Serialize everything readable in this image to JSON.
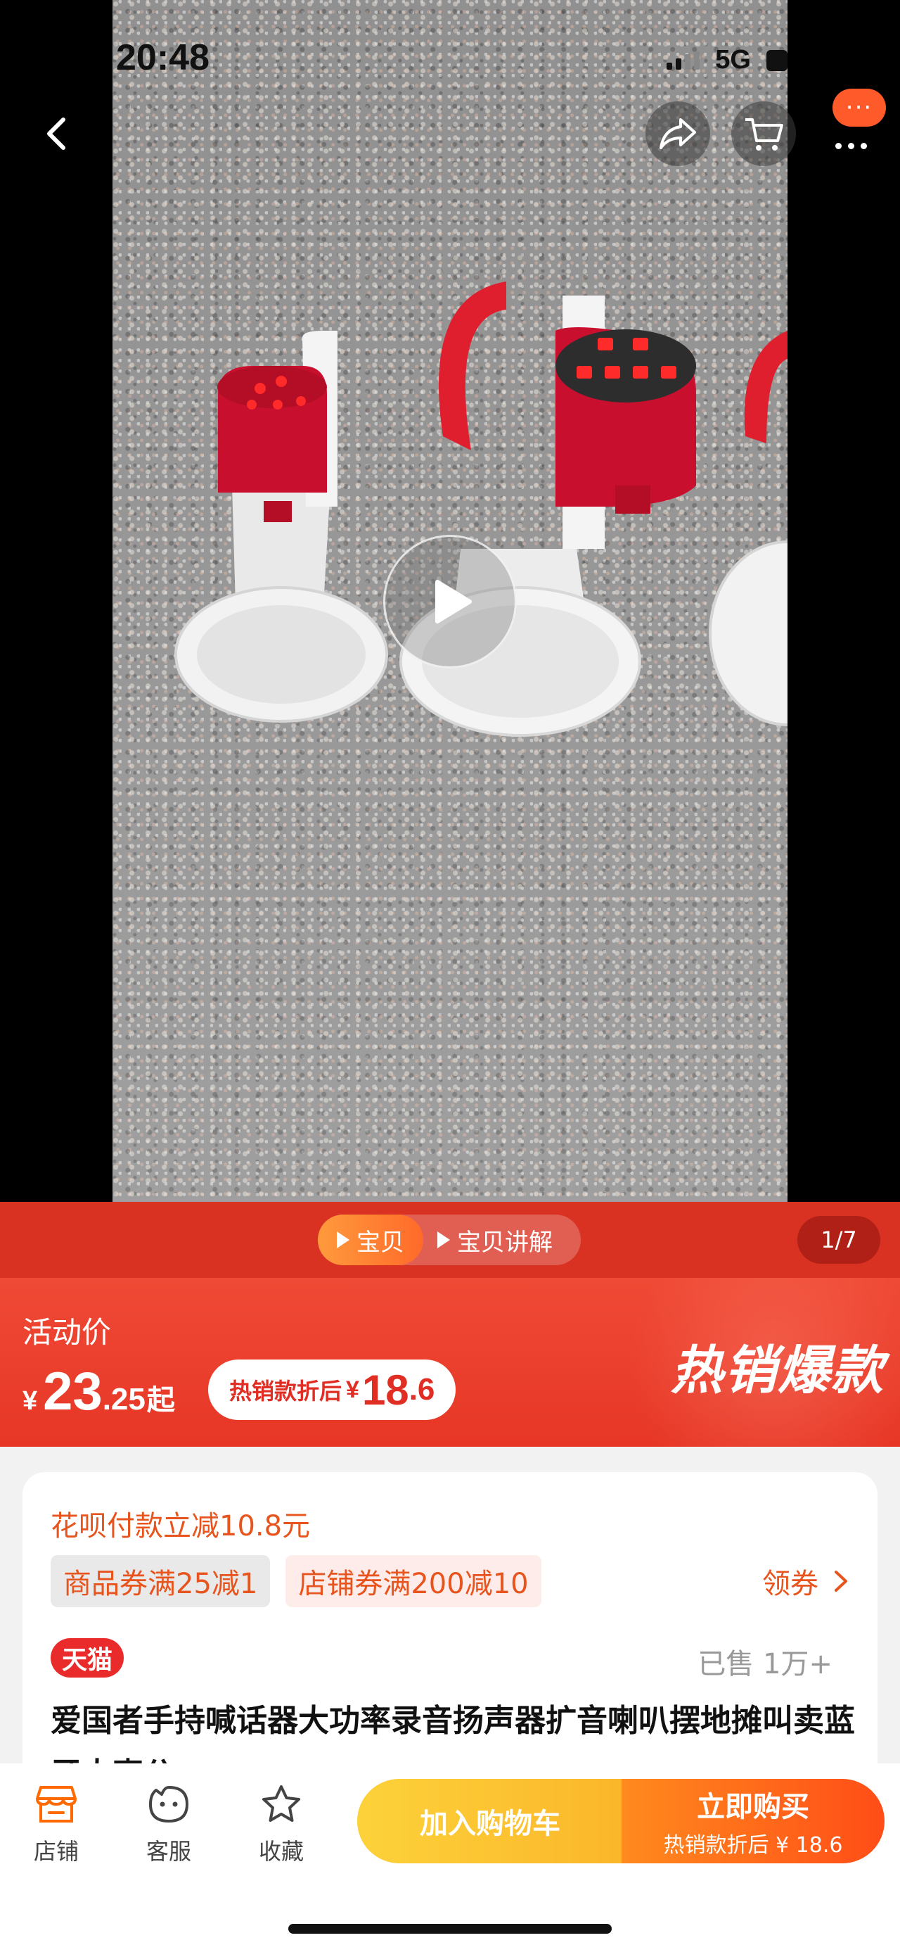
{
  "status_bar": {
    "time": "20:48",
    "network": "5G"
  },
  "header": {
    "back_icon": "chevron-left-icon",
    "share_icon": "share-arrow-icon",
    "cart_icon": "cart-icon",
    "more_icon": "more-dots-icon",
    "message_badge": "···"
  },
  "media": {
    "play_icon": "play-icon"
  },
  "tabs": {
    "items": [
      {
        "label": "宝贝",
        "active": true
      },
      {
        "label": "宝贝讲解",
        "active": false
      }
    ],
    "page_counter": "1/7"
  },
  "price": {
    "promo_label": "活动价",
    "currency": "¥",
    "integer": "23",
    "decimal": ".25",
    "suffix": "起",
    "deal_label": "热销款折后",
    "deal_currency": "¥",
    "deal_integer": "18",
    "deal_decimal": ".6",
    "hot_title": "热销爆款"
  },
  "info": {
    "huabei_text": "花呗付款立减10.8元",
    "coupons": [
      "商品券满25减1",
      "店铺券满200减10"
    ],
    "claim_label": "领券",
    "store_badge": "天猫",
    "sold_count": "已售 1万+",
    "product_title": "爱国者手持喊话器大功率录音扬声器扩音喇叭摆地摊叫卖蓝牙大声公"
  },
  "bottom_bar": {
    "nav": [
      {
        "label": "店铺",
        "icon": "store-icon"
      },
      {
        "label": "客服",
        "icon": "customer-service-icon"
      },
      {
        "label": "收藏",
        "icon": "star-icon"
      }
    ],
    "add_to_cart": "加入购物车",
    "buy_now": "立即购买",
    "buy_now_sub": "热销款折后 ¥ 18.6"
  },
  "colors": {
    "brand_red": "#e73626",
    "accent_orange": "#e8541d",
    "cart_yellow": "#fbb62a",
    "buy_orange": "#ff4d17"
  }
}
